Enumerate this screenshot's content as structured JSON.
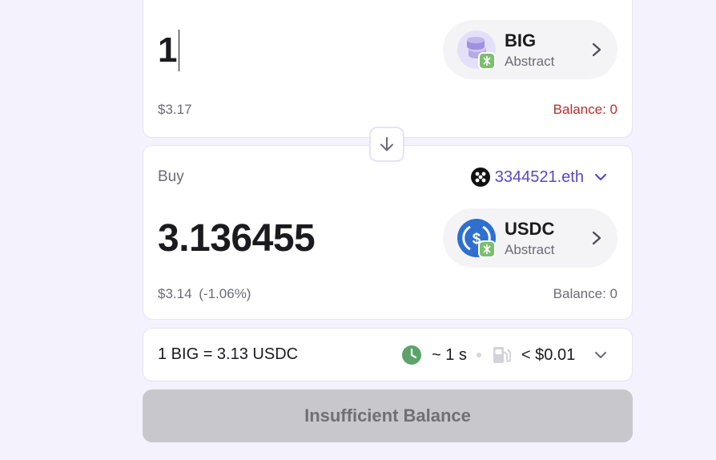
{
  "sell": {
    "amount": "1",
    "usd_value": "$3.17",
    "balance": "Balance: 0",
    "token": {
      "symbol": "BIG",
      "chain": "Abstract",
      "icon": "coin-stack-icon"
    }
  },
  "buy": {
    "label": "Buy",
    "wallet": "3344521.eth",
    "amount": "3.136455",
    "usd_value": "$3.14",
    "price_impact": "(-1.06%)",
    "balance": "Balance: 0",
    "token": {
      "symbol": "USDC",
      "chain": "Abstract",
      "icon": "usdc-icon"
    }
  },
  "quote": {
    "rate": "1 BIG = 3.13 USDC",
    "time": "~ 1 s",
    "fee": "< $0.01"
  },
  "cta": {
    "label": "Insufficient Balance"
  },
  "colors": {
    "background": "#f4f2fd",
    "accent": "#5a48c4",
    "error": "#b52f2f",
    "time_green": "#5ba36a",
    "usdc_blue": "#2e6fd0",
    "chain_badge_green": "#7cbf6c"
  }
}
